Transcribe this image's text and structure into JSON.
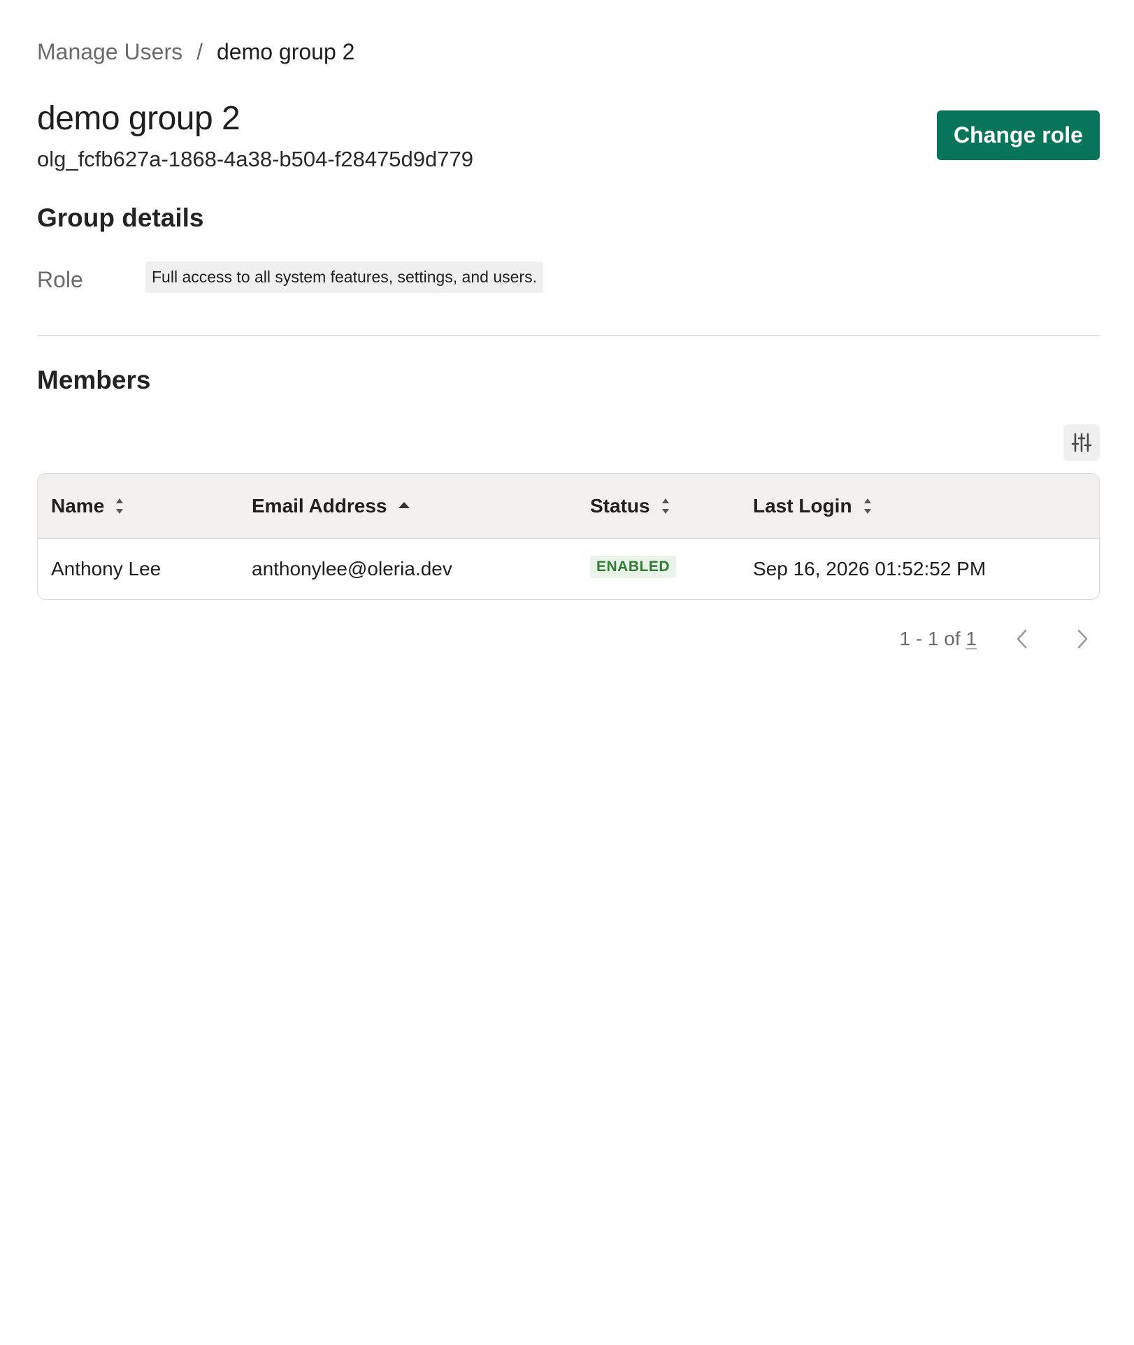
{
  "breadcrumb": {
    "parent": "Manage Users",
    "separator": "/",
    "current": "demo group 2"
  },
  "header": {
    "title": "demo group 2",
    "group_id": "olg_fcfb627a-1868-4a38-b504-f28475d9d779",
    "change_role_label": "Change role"
  },
  "group_details": {
    "title": "Group details",
    "role_label": "Role",
    "role_value": "Full access to all system features, settings, and users."
  },
  "members": {
    "title": "Members",
    "settings_icon": "sliders-icon",
    "columns": [
      {
        "label": "Name",
        "sort": "unsorted"
      },
      {
        "label": "Email Address",
        "sort": "ascending"
      },
      {
        "label": "Status",
        "sort": "unsorted"
      },
      {
        "label": "Last Login",
        "sort": "unsorted"
      }
    ],
    "rows": [
      {
        "name": "Anthony Lee",
        "email": "anthonylee@oleria.dev",
        "status": "ENABLED",
        "last_login": "Sep 16, 2026 01:52:52 PM"
      }
    ],
    "pagination": {
      "range": "1 - 1 of ",
      "total": "1"
    }
  },
  "colors": {
    "accent": "#08755b",
    "status_enabled_text": "#2f7d32",
    "status_enabled_bg": "#eaf3ea",
    "header_bg": "#f1f0ee",
    "muted_text": "#6b6b6b"
  }
}
